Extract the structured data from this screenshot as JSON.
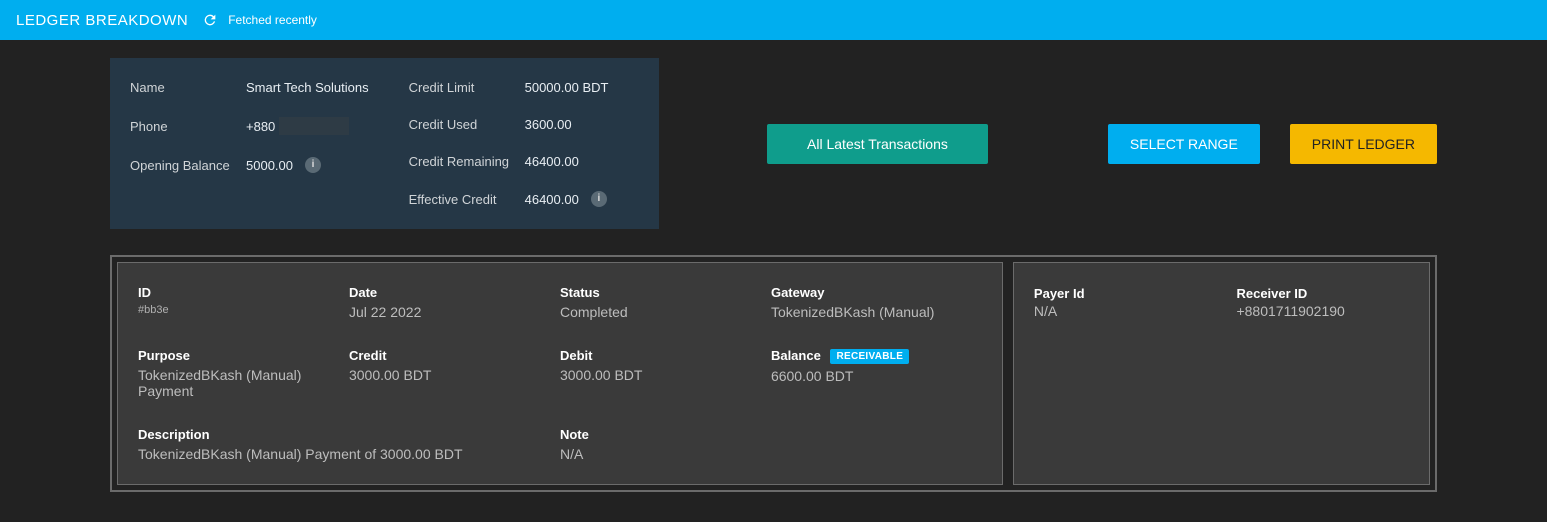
{
  "header": {
    "title": "LEDGER BREAKDOWN",
    "status": "Fetched recently"
  },
  "summary": {
    "name_label": "Name",
    "name_value": "Smart Tech Solutions",
    "phone_label": "Phone",
    "phone_value": "+880",
    "opening_balance_label": "Opening Balance",
    "opening_balance_value": "5000.00",
    "credit_limit_label": "Credit Limit",
    "credit_limit_value": "50000.00 BDT",
    "credit_used_label": "Credit Used",
    "credit_used_value": "3600.00",
    "credit_remaining_label": "Credit Remaining",
    "credit_remaining_value": "46400.00",
    "effective_credit_label": "Effective Credit",
    "effective_credit_value": "46400.00"
  },
  "actions": {
    "latest_label": "All Latest Transactions",
    "select_range_label": "SELECT RANGE",
    "print_ledger_label": "PRINT LEDGER"
  },
  "transaction": {
    "id_label": "ID",
    "id_value": "#bb3e",
    "date_label": "Date",
    "date_value": "Jul 22 2022",
    "status_label": "Status",
    "status_value": "Completed",
    "gateway_label": "Gateway",
    "gateway_value": "TokenizedBKash (Manual)",
    "purpose_label": "Purpose",
    "purpose_value": "TokenizedBKash (Manual) Payment",
    "credit_label": "Credit",
    "credit_value": "3000.00 BDT",
    "debit_label": "Debit",
    "debit_value": "3000.00 BDT",
    "balance_label": "Balance",
    "balance_badge": "RECEIVABLE",
    "balance_value": "6600.00 BDT",
    "description_label": "Description",
    "description_value": "TokenizedBKash (Manual) Payment of 3000.00 BDT",
    "note_label": "Note",
    "note_value": "N/A"
  },
  "parties": {
    "payer_label": "Payer Id",
    "payer_value": "N/A",
    "receiver_label": "Receiver ID",
    "receiver_value": "+8801711902190"
  }
}
